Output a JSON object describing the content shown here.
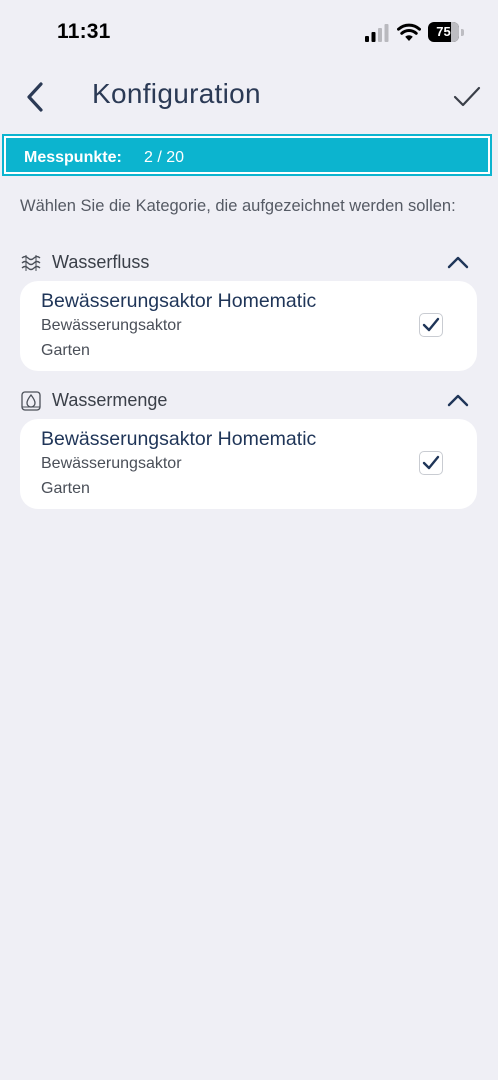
{
  "status_bar": {
    "time": "11:31",
    "battery_percent": "75",
    "battery_level": 0.75
  },
  "nav": {
    "title": "Konfiguration",
    "back_icon": "chevron-left-icon",
    "confirm_icon": "checkmark-icon"
  },
  "banner": {
    "label": "Messpunkte:",
    "value": "2 / 20",
    "color": "#0cb4cf"
  },
  "instruction": "Wählen Sie die Kategorie, die aufgezeichnet werden sollen:",
  "sections": [
    {
      "label": "Wasserfluss",
      "icon": "water-flow-icon",
      "expanded": true,
      "items": [
        {
          "title": "Bewässerungsaktor Homematic",
          "type": "Bewässerungsaktor",
          "location": "Garten",
          "checked": true
        }
      ]
    },
    {
      "label": "Wassermenge",
      "icon": "water-drop-icon",
      "expanded": true,
      "items": [
        {
          "title": "Bewässerungsaktor Homematic",
          "type": "Bewässerungsaktor",
          "location": "Garten",
          "checked": true
        }
      ]
    }
  ]
}
